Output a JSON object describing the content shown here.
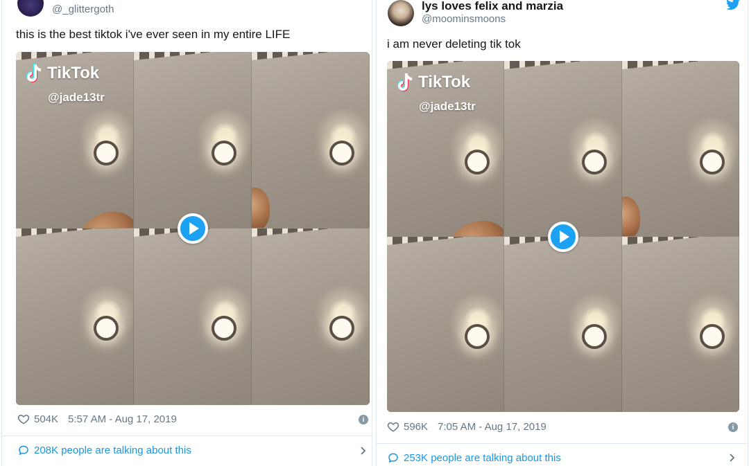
{
  "left_tweet": {
    "handle": "@_glittergoth",
    "text": "this is the best tiktok i've ever seen in my entire LIFE",
    "media": {
      "brand": "TikTok",
      "user": "@jade13tr"
    },
    "likes": "504K",
    "timestamp": "5:57 AM - Aug 17, 2019",
    "talking": "208K people are talking about this"
  },
  "right_tweet": {
    "display_name": "lys loves felix and marzia",
    "handle": "@moominsmoons",
    "text": "i am never deleting tik tok",
    "media": {
      "brand": "TikTok",
      "user": "@jade13tr"
    },
    "likes": "596K",
    "timestamp": "7:05 AM - Aug 17, 2019",
    "talking": "253K people are talking about this"
  },
  "icons": {
    "bird": "twitter-bird-icon",
    "heart": "heart-outline-icon",
    "info": "info-icon",
    "bubble": "speech-bubble-icon",
    "chevron": "chevron-right-icon",
    "play": "play-icon"
  },
  "colors": {
    "twitter_blue": "#1da1f2",
    "link_blue": "#1b95e0",
    "muted_text": "#657786",
    "divider": "#e1e8ed"
  }
}
